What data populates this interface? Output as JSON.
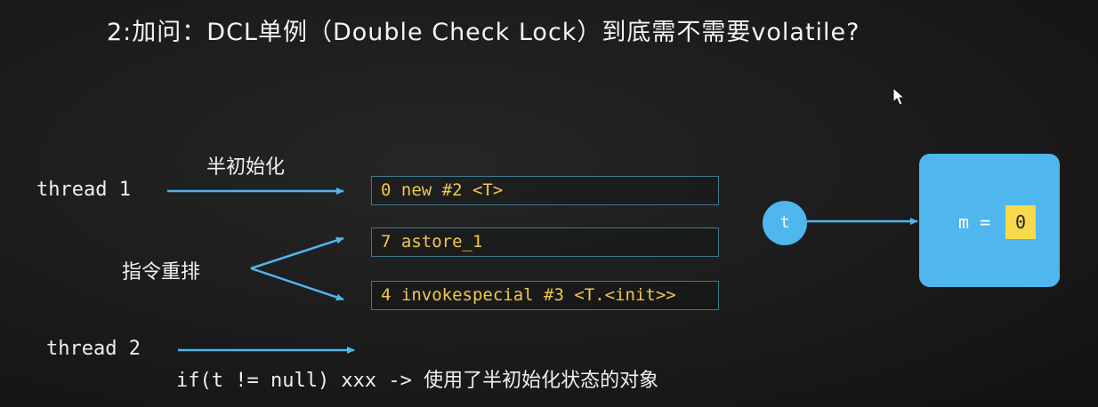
{
  "title": "2:加问：DCL单例（Double Check Lock）到底需不需要volatile?",
  "labels": {
    "thread1": "thread 1",
    "half_init": "半初始化",
    "reorder": "指令重排",
    "thread2": "thread 2",
    "if_line": "if(t != null) xxx -> 使用了半初始化状态的对象"
  },
  "instructions": [
    "0 new #2 <T>",
    "7 astore_1",
    "4 invokespecial #3 <T.<init>>"
  ],
  "reference": {
    "name": "t"
  },
  "object": {
    "field": "m =",
    "value": "0"
  },
  "colors": {
    "accent_blue": "#4fb6ee",
    "code_yellow": "#f0c84a",
    "value_highlight": "#f7d94a"
  }
}
